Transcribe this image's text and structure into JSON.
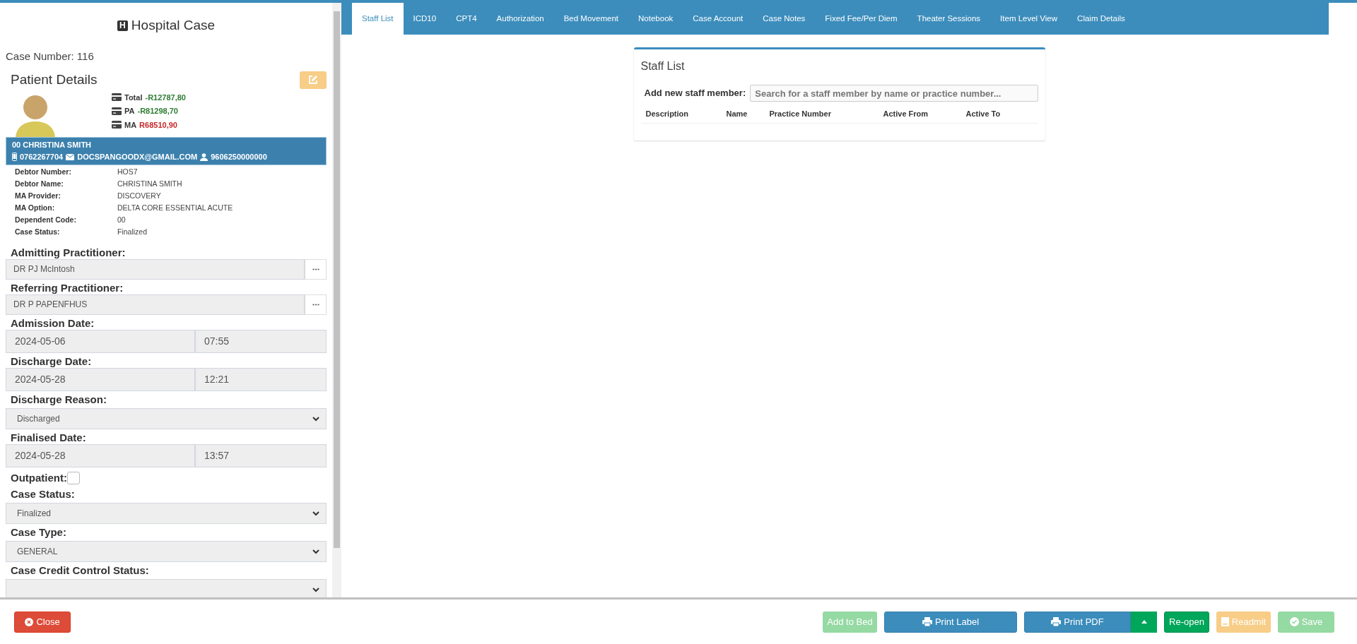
{
  "sidebar": {
    "title_icon": "H",
    "title": "Hospital Case",
    "case_number": "Case Number: 116",
    "section_title": "Patient Details",
    "edit_button": {
      "disabled": true
    },
    "balances": [
      {
        "label": "Total",
        "amount": "-R12787,80",
        "color": "#2e7d32"
      },
      {
        "label": "PA",
        "amount": "-R81298,70",
        "color": "#2e7d32"
      },
      {
        "label": "MA",
        "amount": "R68510,90",
        "color": "#c62828"
      }
    ],
    "patient": {
      "name": "00 CHRISTINA SMITH",
      "phone": "0762267704",
      "email": "DOCSPANGOODX@GMAIL.COM",
      "id_number": "9606250000000"
    },
    "details": [
      {
        "label": "Debtor Number:",
        "value": "HOS7"
      },
      {
        "label": "Debtor Name:",
        "value": "CHRISTINA SMITH"
      },
      {
        "label": "MA Provider:",
        "value": "DISCOVERY"
      },
      {
        "label": "MA Option:",
        "value": "DELTA CORE ESSENTIAL ACUTE"
      },
      {
        "label": "Dependent Code:",
        "value": "00"
      },
      {
        "label": "Case Status:",
        "value": "Finalized"
      }
    ],
    "fields": [
      {
        "kind": "lookup",
        "label": "Admitting Practitioner:",
        "value": "DR PJ McIntosh"
      },
      {
        "kind": "lookup",
        "label": "Referring Practitioner:",
        "value": "DR P PAPENFHUS"
      },
      {
        "kind": "datetime",
        "label": "Admission Date:",
        "date": "2024-05-06",
        "time": "07:55"
      },
      {
        "kind": "datetime",
        "label": "Discharge Date:",
        "date": "2024-05-28",
        "time": "12:21"
      },
      {
        "kind": "select",
        "label": "Discharge Reason:",
        "value": "Discharged"
      },
      {
        "kind": "datetime",
        "label": "Finalised Date:",
        "date": "2024-05-28",
        "time": "13:57"
      },
      {
        "kind": "checkbox",
        "label": "Outpatient:",
        "checked": false
      },
      {
        "kind": "select",
        "label": "Case Status:",
        "value": "Finalized"
      },
      {
        "kind": "select",
        "label": "Case Type:",
        "value": "GENERAL"
      },
      {
        "kind": "select",
        "label": "Case Credit Control Status:"
      }
    ]
  },
  "tabs": [
    {
      "label": "Staff List",
      "selected": true
    },
    {
      "label": "ICD10",
      "selected": false
    },
    {
      "label": "CPT4",
      "selected": false
    },
    {
      "label": "Authorization",
      "selected": false
    },
    {
      "label": "Bed Movement",
      "selected": false
    },
    {
      "label": "Notebook",
      "selected": false
    },
    {
      "label": "Case Account",
      "selected": false
    },
    {
      "label": "Case Notes",
      "selected": false
    },
    {
      "label": "Fixed Fee/Per Diem",
      "selected": false
    },
    {
      "label": "Theater Sessions",
      "selected": false
    },
    {
      "label": "Item Level View",
      "selected": false
    },
    {
      "label": "Claim Details",
      "selected": false
    }
  ],
  "staff_list": {
    "title": "Staff List",
    "add_label": "Add new staff member:",
    "search": {
      "placeholder": "Search for a staff member by name or practice number..."
    },
    "columns": [
      "Description",
      "Name",
      "Practice Number",
      "Active From",
      "Active To"
    ]
  },
  "footer": {
    "close_button": {
      "label": "Close",
      "disabled": false
    },
    "add_to_bed_button": {
      "label": "Add to Bed",
      "disabled": true
    },
    "print_label_button": {
      "label": "Print Label",
      "disabled": false
    },
    "print_pdf_button": {
      "label": "Print PDF",
      "disabled": false
    },
    "reopen_button": {
      "label": "Re-open",
      "disabled": false
    },
    "readmit_button": {
      "label": "Readmit",
      "disabled": true
    },
    "save_button": {
      "label": "Save",
      "disabled": true
    }
  }
}
